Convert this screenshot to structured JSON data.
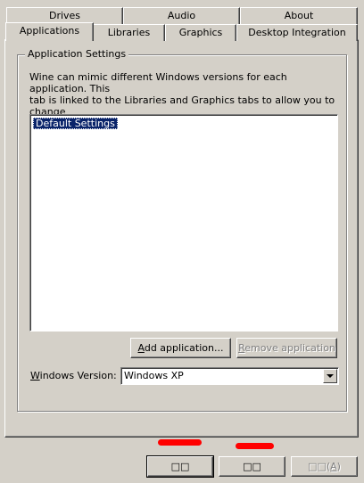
{
  "tabs_row1": [
    {
      "label": "Drives"
    },
    {
      "label": "Audio"
    },
    {
      "label": "About"
    }
  ],
  "tabs_row2": [
    {
      "label": "Applications",
      "selected": true
    },
    {
      "label": "Libraries"
    },
    {
      "label": "Graphics"
    },
    {
      "label": "Desktop Integration"
    }
  ],
  "group": {
    "title": "Application Settings",
    "description": "Wine can mimic different Windows versions for each application.  This\ntab is linked to the Libraries and Graphics tabs to allow you to change\nsystemwide or per-application settings in those tabs as well."
  },
  "app_list": {
    "items": [
      "Default Settings"
    ],
    "selected": "Default Settings"
  },
  "buttons": {
    "add": {
      "prefix": "",
      "accel": "A",
      "rest": "dd application..."
    },
    "remove": {
      "prefix": "",
      "accel": "R",
      "rest": "emove application"
    }
  },
  "version": {
    "label_accel": "W",
    "label_rest": "indows Version:",
    "value": "Windows XP"
  },
  "dialog_buttons": {
    "ok": "□□",
    "cancel": "□□",
    "apply_text": "□□(",
    "apply_accel": "A",
    "apply_close": ")"
  },
  "colors": {
    "face": "#d4d0c8",
    "selection": "#0a246a",
    "annotation": "#ff0000"
  }
}
